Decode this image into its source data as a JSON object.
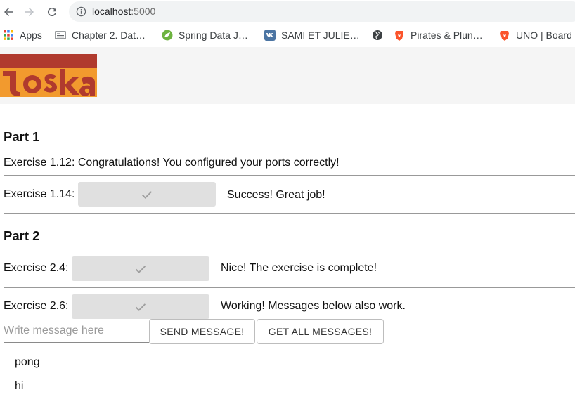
{
  "browser": {
    "url_host": "localhost",
    "url_port": ":5000",
    "bookmarks": [
      {
        "label": "Apps",
        "icon": "apps-grid-icon"
      },
      {
        "label": "Chapter 2. Dat…",
        "icon": "document-icon"
      },
      {
        "label": "Spring Data J…",
        "icon": "spring-leaf-icon"
      },
      {
        "label": "SAMI ET JULIE…",
        "icon": "vk-icon"
      },
      {
        "label": "",
        "icon": "globe-icon"
      },
      {
        "label": "Pirates & Plun…",
        "icon": "brave-lion-icon"
      },
      {
        "label": "UNO | Board",
        "icon": "brave-lion-icon"
      }
    ]
  },
  "logo": {
    "text": "toska",
    "colors": {
      "orange": "#f29a2e",
      "red": "#b03a2e"
    }
  },
  "part1": {
    "title": "Part 1",
    "ex112": "Exercise 1.12: Congratulations! You configured your ports correctly!",
    "ex114_label": "Exercise 1.14:",
    "ex114_status": "Success! Great job!"
  },
  "part2": {
    "title": "Part 2",
    "ex24_label": "Exercise 2.4:",
    "ex24_status": "Nice! The exercise is complete!",
    "ex26_label": "Exercise 2.6:",
    "ex26_status": "Working! Messages below also work.",
    "message_placeholder": "Write message here",
    "send_label": "SEND MESSAGE!",
    "get_all_label": "GET ALL MESSAGES!",
    "messages": [
      "pong",
      "hi"
    ]
  }
}
